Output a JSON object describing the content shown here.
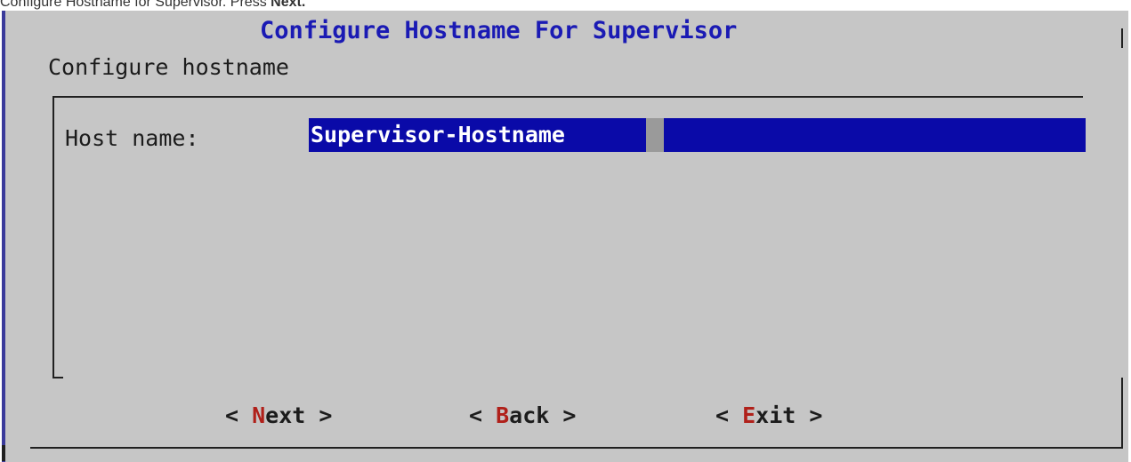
{
  "caption": {
    "prefix": "Configure Hostname for Supervisor. Press ",
    "strong": "Next."
  },
  "dialog": {
    "title": "Configure Hostname For Supervisor",
    "subtitle": "Configure hostname"
  },
  "form": {
    "host_label": "Host name:",
    "host_value": "Supervisor-Hostname"
  },
  "buttons": [
    {
      "open": "< ",
      "hotkey": "N",
      "rest": "ext",
      "close": " >"
    },
    {
      "open": "< ",
      "hotkey": "B",
      "rest": "ack",
      "close": " >"
    },
    {
      "open": "< ",
      "hotkey": "E",
      "rest": "xit",
      "close": " >"
    }
  ],
  "colors": {
    "dialog_bg": "#c6c6c6",
    "title": "#1a1ab4",
    "input_bg": "#0a0aa8",
    "input_text": "#ffffff",
    "cursor": "#9a9a9a",
    "hotkey": "#b0201a",
    "left_border": "#3a3a9a"
  }
}
